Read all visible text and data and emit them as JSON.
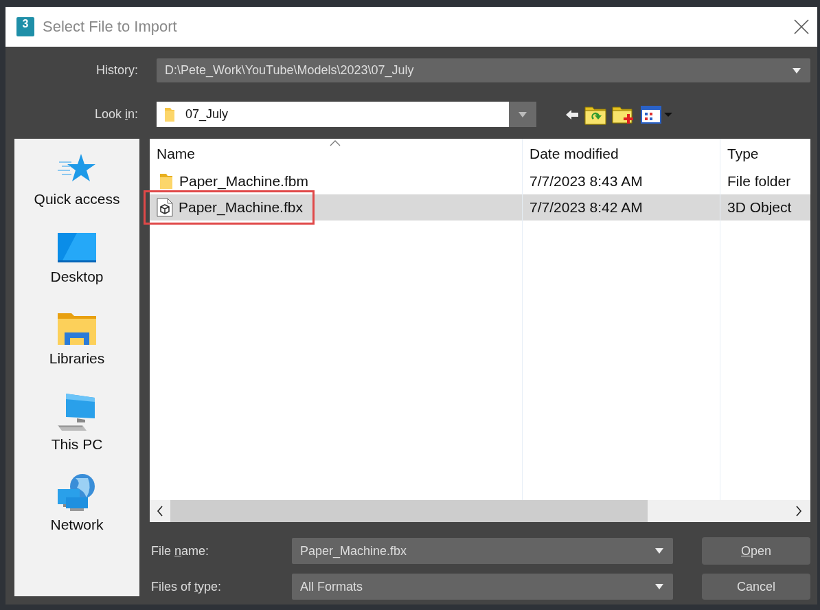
{
  "window": {
    "title": "Select File to Import",
    "app_icon_label": "3"
  },
  "history": {
    "label": "History:",
    "value": "D:\\Pete_Work\\YouTube\\Models\\2023\\07_July"
  },
  "look_in": {
    "label_parts": {
      "before": "Look ",
      "key": "i",
      "after": "n:"
    },
    "value": "07_July"
  },
  "sidebar": {
    "items": [
      {
        "label": "Quick access",
        "kind": "star",
        "selected": false
      },
      {
        "label": "Desktop",
        "kind": "desktop",
        "selected": false
      },
      {
        "label": "Libraries",
        "kind": "libraries",
        "selected": false
      },
      {
        "label": "This PC",
        "kind": "pc",
        "selected": false
      },
      {
        "label": "Network",
        "kind": "network",
        "selected": false
      }
    ]
  },
  "table": {
    "columns": [
      "Name",
      "Date modified",
      "Type"
    ],
    "rows": [
      {
        "kind": "folder",
        "name": "Paper_Machine.fbm",
        "date": "7/7/2023 8:43 AM",
        "type": "File folder",
        "selected": false,
        "highlighted": false
      },
      {
        "kind": "file",
        "name": "Paper_Machine.fbx",
        "date": "7/7/2023 8:42 AM",
        "type": "3D Object",
        "selected": true,
        "highlighted": true
      }
    ]
  },
  "file_name": {
    "label_parts": {
      "before": "File ",
      "key": "n",
      "after": "ame:"
    },
    "value": "Paper_Machine.fbx"
  },
  "file_type": {
    "label_parts": {
      "before": "Files of ",
      "key": "t",
      "after": "ype:"
    },
    "value": "All Formats"
  },
  "buttons": [
    {
      "label_parts": {
        "key": "O",
        "after": "pen"
      }
    },
    {
      "label_parts": {
        "before": "Cancel"
      }
    }
  ]
}
